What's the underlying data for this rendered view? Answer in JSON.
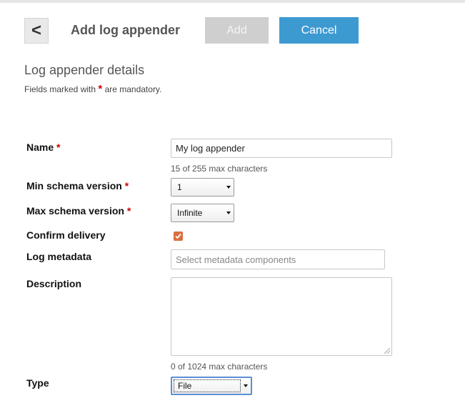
{
  "header": {
    "back_label": "<",
    "title": "Add log appender",
    "add_label": "Add",
    "cancel_label": "Cancel"
  },
  "section": {
    "title": "Log appender details",
    "note_prefix": "Fields marked with",
    "note_star": "*",
    "note_suffix": "are mandatory."
  },
  "form": {
    "name": {
      "label": "Name",
      "required": "*",
      "value": "My log appender",
      "hint": "15 of 255 max characters"
    },
    "min_schema": {
      "label": "Min schema version",
      "required": "*",
      "value": "1"
    },
    "max_schema": {
      "label": "Max schema version",
      "required": "*",
      "value": "Infinite"
    },
    "confirm_delivery": {
      "label": "Confirm delivery",
      "checked": true
    },
    "log_metadata": {
      "label": "Log metadata",
      "placeholder": "Select metadata components"
    },
    "description": {
      "label": "Description",
      "value": "",
      "hint": "0 of 1024 max characters"
    },
    "type": {
      "label": "Type",
      "value": "File"
    }
  },
  "colors": {
    "accent": "#3d9ad1",
    "disabled": "#cfcfcf",
    "required": "#cc0000",
    "checkbox": "#d9703f"
  }
}
